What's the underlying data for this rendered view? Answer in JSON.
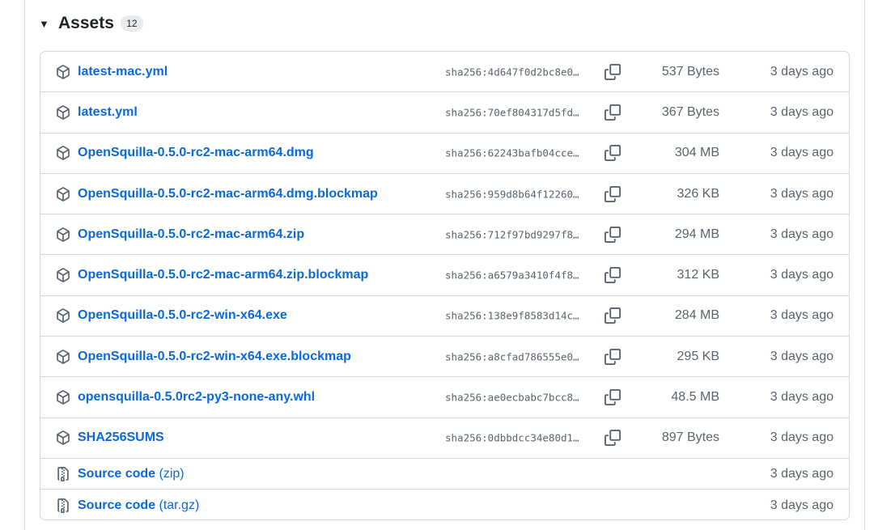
{
  "assets": {
    "title": "Assets",
    "count": "12",
    "files": [
      {
        "name": "latest-mac.yml",
        "sha": "sha256:4d647f0d2bc8e0…",
        "size": "537 Bytes",
        "date": "3 days ago"
      },
      {
        "name": "latest.yml",
        "sha": "sha256:70ef804317d5fd…",
        "size": "367 Bytes",
        "date": "3 days ago"
      },
      {
        "name": "OpenSquilla-0.5.0-rc2-mac-arm64.dmg",
        "sha": "sha256:62243bafb04cce…",
        "size": "304 MB",
        "date": "3 days ago"
      },
      {
        "name": "OpenSquilla-0.5.0-rc2-mac-arm64.dmg.blockmap",
        "sha": "sha256:959d8b64f12260…",
        "size": "326 KB",
        "date": "3 days ago"
      },
      {
        "name": "OpenSquilla-0.5.0-rc2-mac-arm64.zip",
        "sha": "sha256:712f97bd9297f8…",
        "size": "294 MB",
        "date": "3 days ago"
      },
      {
        "name": "OpenSquilla-0.5.0-rc2-mac-arm64.zip.blockmap",
        "sha": "sha256:a6579a3410f4f8…",
        "size": "312 KB",
        "date": "3 days ago"
      },
      {
        "name": "OpenSquilla-0.5.0-rc2-win-x64.exe",
        "sha": "sha256:138e9f8583d14c…",
        "size": "284 MB",
        "date": "3 days ago"
      },
      {
        "name": "OpenSquilla-0.5.0-rc2-win-x64.exe.blockmap",
        "sha": "sha256:a8cfad786555e0…",
        "size": "295 KB",
        "date": "3 days ago"
      },
      {
        "name": "opensquilla-0.5.0rc2-py3-none-any.whl",
        "sha": "sha256:ae0ecbabc7bcc8…",
        "size": "48.5 MB",
        "date": "3 days ago"
      },
      {
        "name": "SHA256SUMS",
        "sha": "sha256:0dbbdcc34e80d1…",
        "size": "897 Bytes",
        "date": "3 days ago"
      }
    ],
    "source": [
      {
        "label": "Source code",
        "ext": "(zip)",
        "date": "3 days ago"
      },
      {
        "label": "Source code",
        "ext": "(tar.gz)",
        "date": "3 days ago"
      }
    ]
  }
}
